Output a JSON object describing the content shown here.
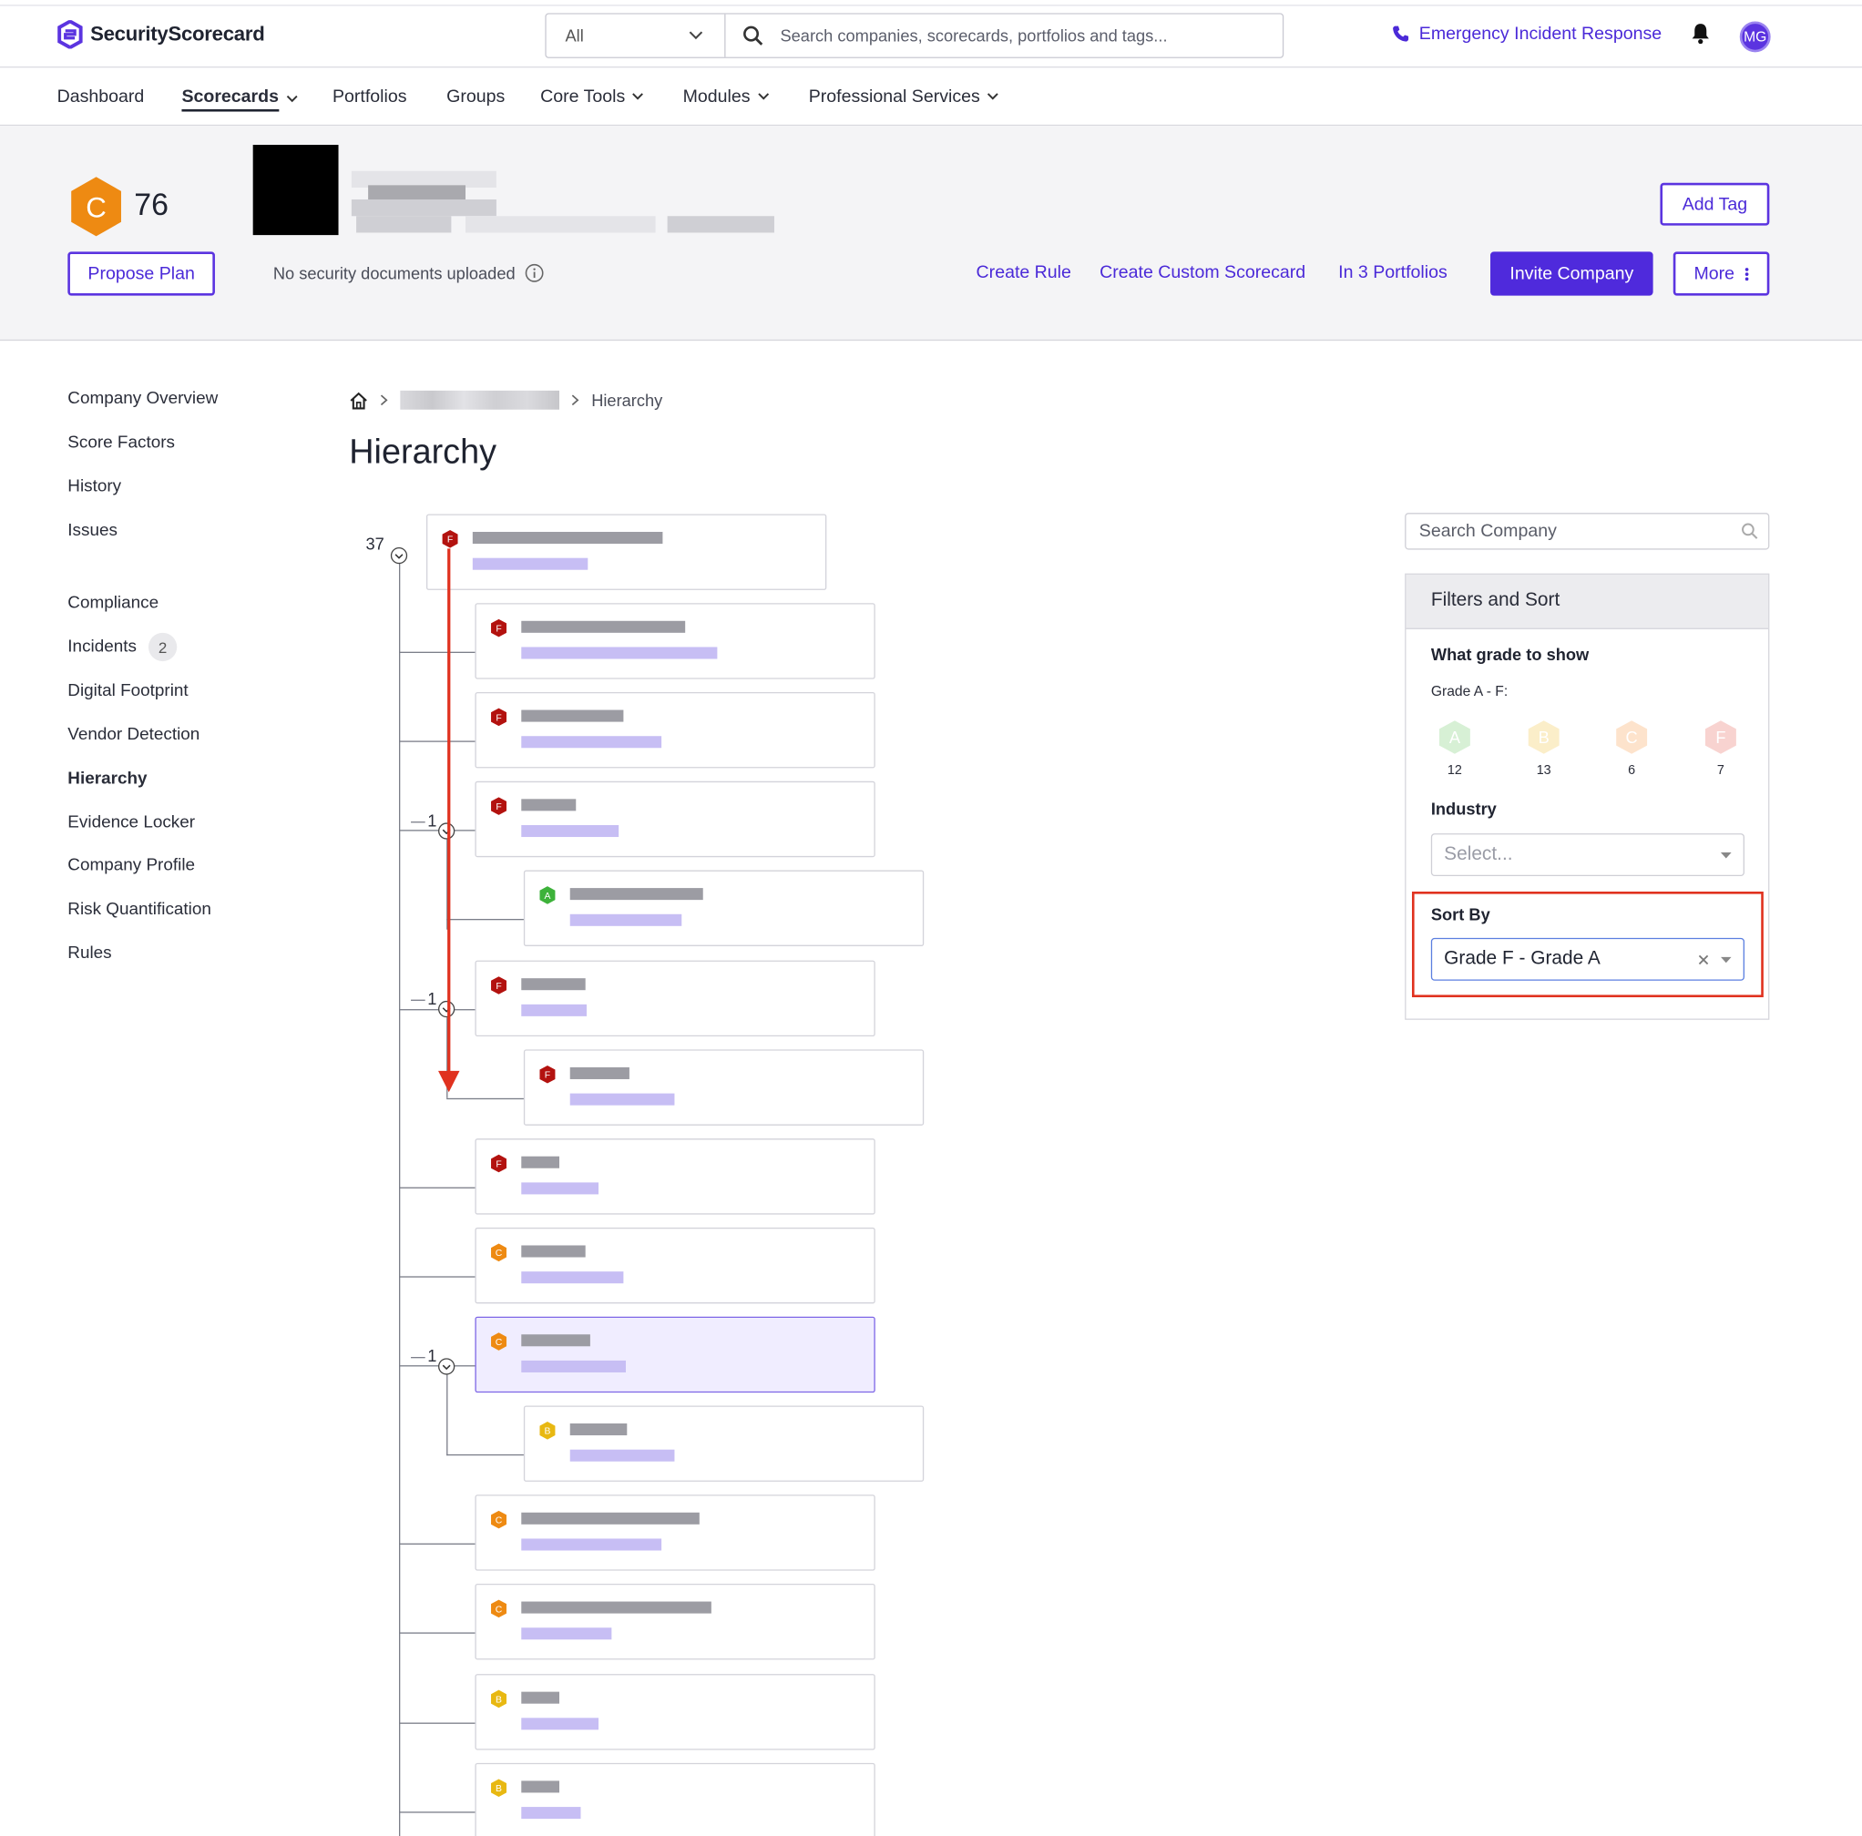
{
  "app": {
    "logo_text": "SecurityScorecard",
    "search_scope": "All",
    "search_placeholder": "Search companies, scorecards, portfolios and tags...",
    "emergency_label": "Emergency Incident Response",
    "avatar_initials": "MG"
  },
  "nav": {
    "items": [
      {
        "label": "Dashboard"
      },
      {
        "label": "Scorecards"
      },
      {
        "label": "Portfolios"
      },
      {
        "label": "Groups"
      },
      {
        "label": "Core Tools"
      },
      {
        "label": "Modules"
      },
      {
        "label": "Professional Services"
      }
    ],
    "active": "Scorecards"
  },
  "company": {
    "grade": "C",
    "score": "76",
    "add_tag": "Add Tag",
    "propose_plan": "Propose Plan",
    "no_docs": "No security documents uploaded",
    "create_rule": "Create Rule",
    "create_custom": "Create Custom Scorecard",
    "portfolios": "In 3 Portfolios",
    "invite": "Invite Company",
    "more": "More"
  },
  "sidebar": {
    "items": [
      {
        "label": "Company Overview"
      },
      {
        "label": "Score Factors"
      },
      {
        "label": "History"
      },
      {
        "label": "Issues"
      },
      {
        "label": "Compliance"
      },
      {
        "label": "Incidents",
        "badge": "2"
      },
      {
        "label": "Digital Footprint"
      },
      {
        "label": "Vendor Detection"
      },
      {
        "label": "Hierarchy"
      },
      {
        "label": "Evidence Locker"
      },
      {
        "label": "Company Profile"
      },
      {
        "label": "Risk Quantification"
      },
      {
        "label": "Rules"
      }
    ],
    "active": "Hierarchy"
  },
  "breadcrumb": {
    "current": "Hierarchy"
  },
  "page": {
    "title": "Hierarchy"
  },
  "tree": {
    "root_count": "37",
    "child_count_1": "1",
    "child_count_2": "1",
    "child_count_3": "1",
    "node_grades": [
      "F",
      "F",
      "F",
      "F",
      "A",
      "F",
      "F",
      "F",
      "C",
      "C",
      "B",
      "C",
      "C",
      "B",
      "B"
    ]
  },
  "filters": {
    "search_placeholder": "Search Company",
    "title": "Filters and Sort",
    "grade_label": "What grade to show",
    "grade_range": "Grade A - F:",
    "grades": [
      {
        "grade": "A",
        "count": "12"
      },
      {
        "grade": "B",
        "count": "13"
      },
      {
        "grade": "C",
        "count": "6"
      },
      {
        "grade": "F",
        "count": "7"
      }
    ],
    "industry_label": "Industry",
    "industry_placeholder": "Select...",
    "sort_label": "Sort By",
    "sort_value": "Grade F - Grade A"
  },
  "colors": {
    "accent": "#4f2adc",
    "grade_F": "#b3120f",
    "grade_C": "#ee8a12",
    "grade_B": "#e8b812",
    "grade_A": "#3db23a",
    "annotation": "#e0321f"
  }
}
